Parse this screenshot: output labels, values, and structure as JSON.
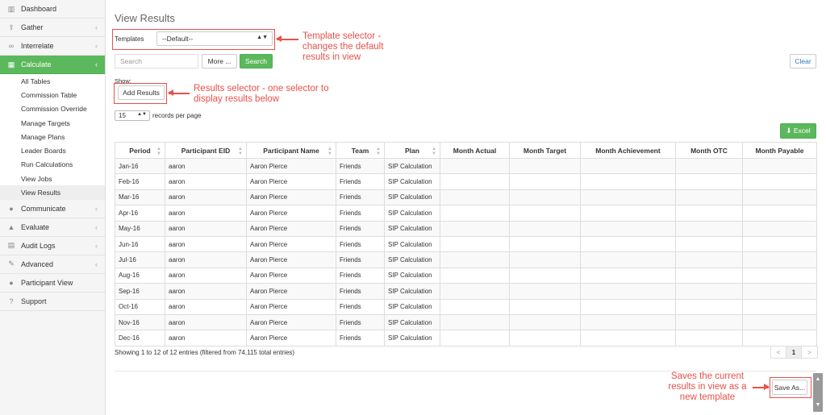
{
  "sidebar": {
    "items": [
      {
        "label": "Dashboard",
        "icon": "bar-chart-icon",
        "glyph": "▥",
        "chevron": false
      },
      {
        "label": "Gather",
        "icon": "upload-icon",
        "glyph": "⇪",
        "chevron": true
      },
      {
        "label": "Interrelate",
        "icon": "link-icon",
        "glyph": "∞",
        "chevron": true
      },
      {
        "label": "Calculate",
        "icon": "table-icon",
        "glyph": "▦",
        "chevron": true,
        "active": true
      },
      {
        "label": "Communicate",
        "icon": "comment-icon",
        "glyph": "●",
        "chevron": true
      },
      {
        "label": "Evaluate",
        "icon": "thumbs-up-icon",
        "glyph": "▲",
        "chevron": true
      },
      {
        "label": "Audit Logs",
        "icon": "list-icon",
        "glyph": "▤",
        "chevron": true
      },
      {
        "label": "Advanced",
        "icon": "wrench-icon",
        "glyph": "✎",
        "chevron": true
      },
      {
        "label": "Participant View",
        "icon": "user-icon",
        "glyph": "●",
        "chevron": false
      },
      {
        "label": "Support",
        "icon": "question-icon",
        "glyph": "?",
        "chevron": false
      }
    ],
    "calculate_sub": [
      "All Tables",
      "Commission Table",
      "Commission Override",
      "Manage Targets",
      "Manage Plans",
      "Leader Boards",
      "Run Calculations",
      "View Jobs",
      "View Results"
    ],
    "chevron_glyph": "‹"
  },
  "page": {
    "title": "View Results",
    "templates_label": "Templates",
    "template_value": "--Default--",
    "search_placeholder": "Search",
    "more_label": "More ...",
    "search_label": "Search",
    "clear_label": "Clear",
    "show_label": "Show:",
    "add_results_label": "Add Results",
    "rpp_value": "15",
    "rpp_text": "records per page",
    "excel_label": "⬇ Excel",
    "info": "Showing 1 to 12 of 12 entries (filtered from 74,115 total entries)",
    "pager": [
      "<",
      "1",
      ">"
    ],
    "save_as_label": "Save As...",
    "scroll_up": "▲",
    "scroll_down": "▼"
  },
  "table": {
    "columns": [
      "Period",
      "Participant EID",
      "Participant Name",
      "Team",
      "Plan",
      "Month Actual",
      "Month Target",
      "Month Achievement",
      "Month OTC",
      "Month Payable"
    ],
    "sortable": [
      true,
      true,
      true,
      true,
      true,
      false,
      false,
      false,
      false,
      false
    ],
    "rows": [
      [
        "Jan-16",
        "aaron",
        "Aaron Pierce",
        "Friends",
        "SIP Calculation",
        "",
        "",
        "",
        "",
        ""
      ],
      [
        "Feb-16",
        "aaron",
        "Aaron Pierce",
        "Friends",
        "SIP Calculation",
        "",
        "",
        "",
        "",
        ""
      ],
      [
        "Mar-16",
        "aaron",
        "Aaron Pierce",
        "Friends",
        "SIP Calculation",
        "",
        "",
        "",
        "",
        ""
      ],
      [
        "Apr-16",
        "aaron",
        "Aaron Pierce",
        "Friends",
        "SIP Calculation",
        "",
        "",
        "",
        "",
        ""
      ],
      [
        "May-16",
        "aaron",
        "Aaron Pierce",
        "Friends",
        "SIP Calculation",
        "",
        "",
        "",
        "",
        ""
      ],
      [
        "Jun-16",
        "aaron",
        "Aaron Pierce",
        "Friends",
        "SIP Calculation",
        "",
        "",
        "",
        "",
        ""
      ],
      [
        "Jul-16",
        "aaron",
        "Aaron Pierce",
        "Friends",
        "SIP Calculation",
        "",
        "",
        "",
        "",
        ""
      ],
      [
        "Aug-16",
        "aaron",
        "Aaron Pierce",
        "Friends",
        "SIP Calculation",
        "",
        "",
        "",
        "",
        ""
      ],
      [
        "Sep-16",
        "aaron",
        "Aaron Pierce",
        "Friends",
        "SIP Calculation",
        "",
        "",
        "",
        "",
        ""
      ],
      [
        "Oct-16",
        "aaron",
        "Aaron Pierce",
        "Friends",
        "SIP Calculation",
        "",
        "",
        "",
        "",
        ""
      ],
      [
        "Nov-16",
        "aaron",
        "Aaron Pierce",
        "Friends",
        "SIP Calculation",
        "",
        "",
        "",
        "",
        ""
      ],
      [
        "Dec-16",
        "aaron",
        "Aaron Pierce",
        "Friends",
        "SIP Calculation",
        "",
        "",
        "",
        "",
        ""
      ]
    ]
  },
  "annotations": {
    "template": [
      "Template selector -",
      "changes the default",
      "results in view"
    ],
    "results": [
      "Results selector - one selector to",
      "display results below"
    ],
    "save": [
      "Saves the current",
      "results in view as a",
      "new template"
    ],
    "color": "#e8514a"
  },
  "colors": {
    "accent_green": "#5cb85c",
    "link_blue": "#337ab7"
  }
}
